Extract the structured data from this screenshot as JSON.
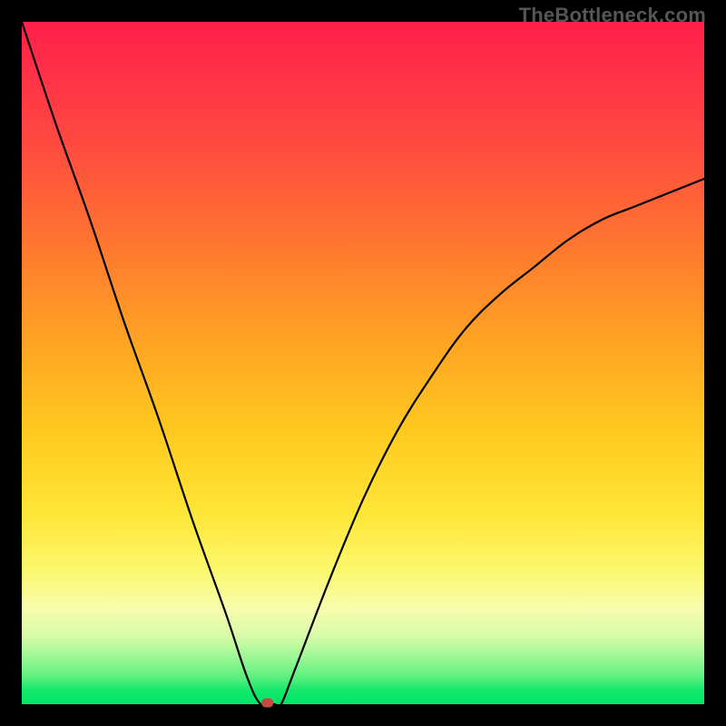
{
  "watermark": "TheBottleneck.com",
  "chart_data": {
    "type": "line",
    "title": "",
    "xlabel": "",
    "ylabel": "",
    "xlim": [
      0,
      100
    ],
    "ylim": [
      0,
      100
    ],
    "grid": false,
    "legend": false,
    "series": [
      {
        "name": "bottleneck-curve",
        "x": [
          0,
          5,
          10,
          15,
          20,
          25,
          30,
          33,
          35,
          37,
          38,
          40,
          45,
          50,
          55,
          60,
          65,
          70,
          75,
          80,
          85,
          90,
          95,
          100
        ],
        "y": [
          100,
          85,
          71,
          56,
          42,
          27,
          13,
          4,
          0,
          0,
          0,
          5,
          18,
          30,
          40,
          48,
          55,
          60,
          64,
          68,
          71,
          73,
          75,
          77
        ]
      }
    ],
    "marker": {
      "x": 36,
      "y": 0,
      "color": "#c24a3f"
    },
    "background_gradient": {
      "top": "#ff1f4b",
      "mid": "#ffe637",
      "bottom": "#00e566"
    }
  }
}
